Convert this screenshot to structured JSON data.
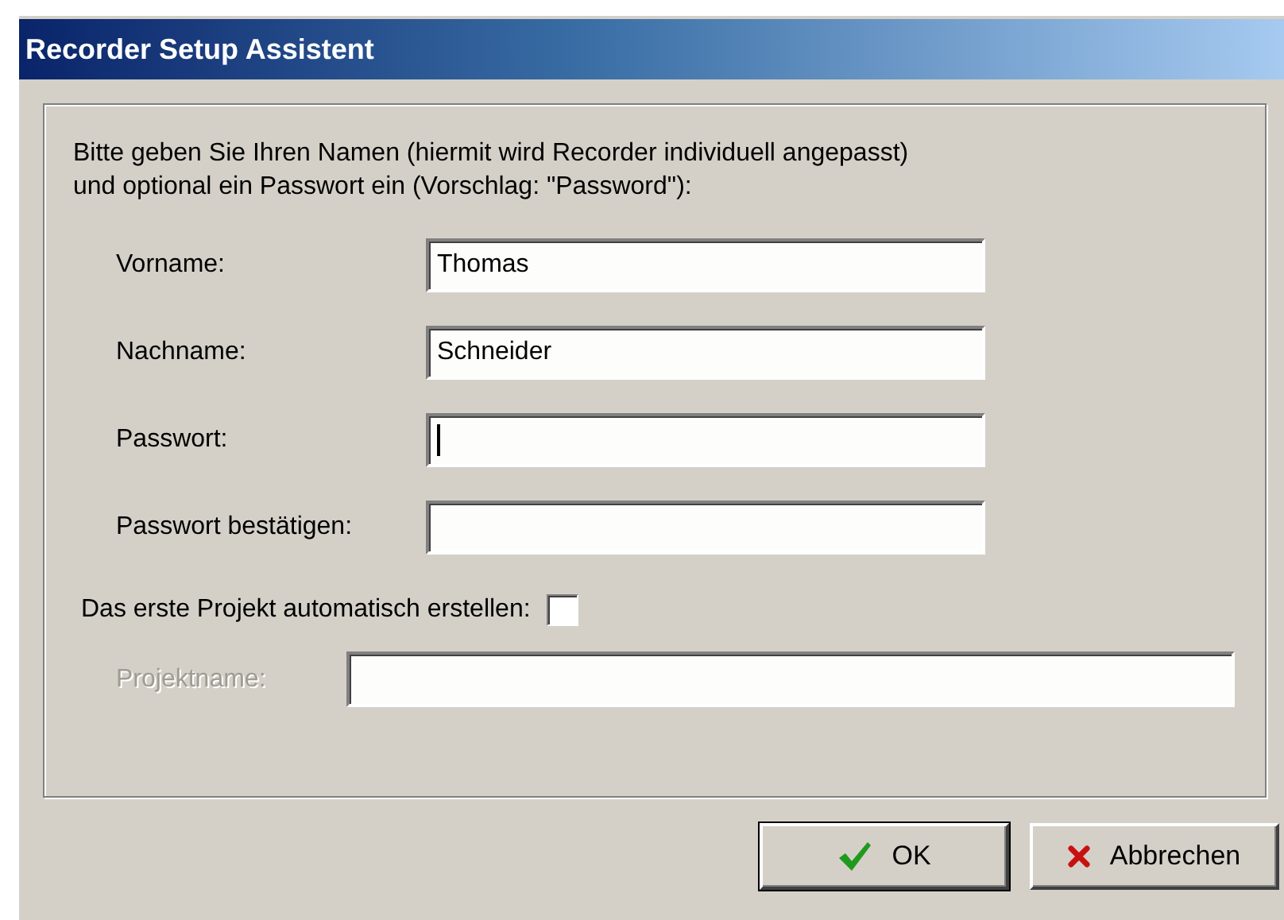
{
  "window": {
    "title": "Recorder Setup Assistent"
  },
  "intro": "Bitte geben Sie Ihren Namen (hiermit wird Recorder individuell angepasst)\nund optional ein Passwort ein (Vorschlag: \"Password\"):",
  "fields": [
    {
      "label": "Vorname:",
      "value": "Thomas",
      "focused": false
    },
    {
      "label": "Nachname:",
      "value": "Schneider",
      "focused": false
    },
    {
      "label": "Passwort:",
      "focused": true
    },
    {
      "label": "Passwort bestätigen:",
      "focused": false
    }
  ],
  "auto_project": {
    "label": "Das erste Projekt automatisch erstellen:",
    "checked": false
  },
  "project_name": {
    "label": "Projektname:",
    "disabled": true
  },
  "buttons": [
    {
      "label": "OK",
      "kind": "ok"
    },
    {
      "label": "Abbrechen",
      "kind": "cancel"
    }
  ]
}
